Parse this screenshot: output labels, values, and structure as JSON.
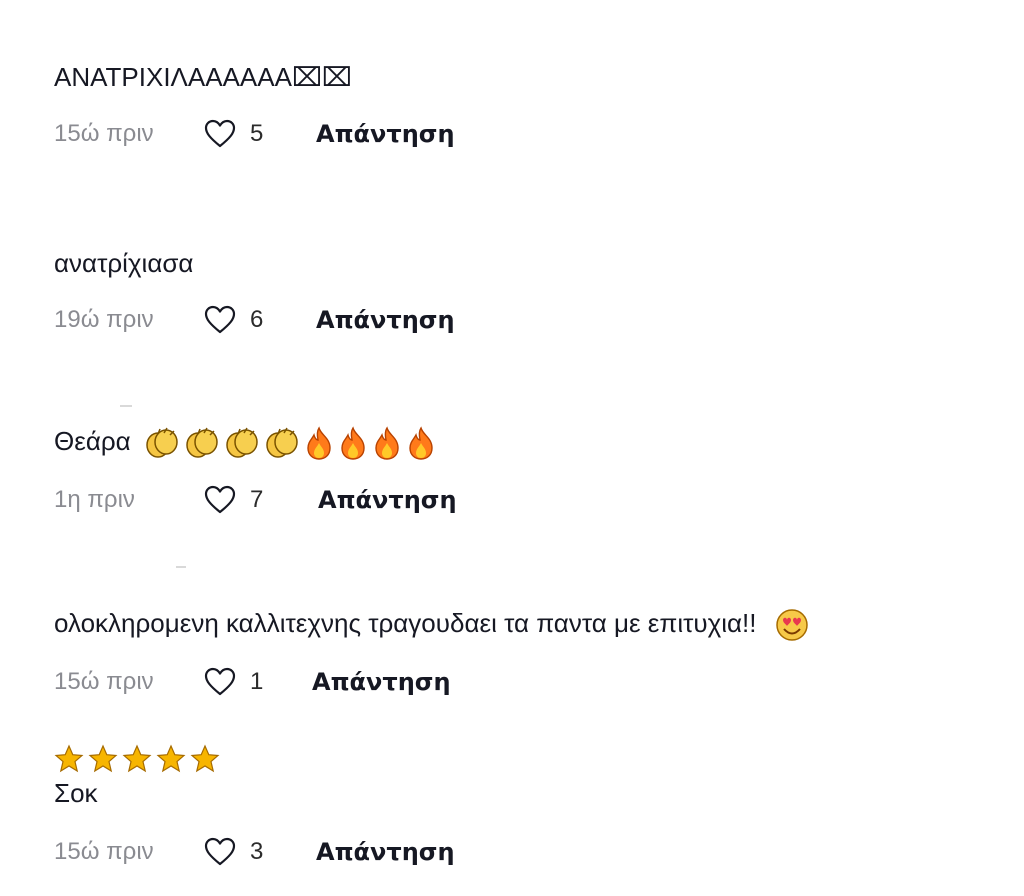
{
  "comments": [
    {
      "text": "ΑΝΑΤΡΙΧΙΛΑΑΑΑΑΑ⌧⌧",
      "time": "15ώ πριν",
      "likes": "5",
      "reply_label": "Απάντηση",
      "emojis": []
    },
    {
      "text": "ανατρίχιασα",
      "time": "19ώ πριν",
      "likes": "6",
      "reply_label": "Απάντηση",
      "emojis": []
    },
    {
      "text": "Θεάρα",
      "time": "1η πριν",
      "likes": "7",
      "reply_label": "Απάντηση",
      "emojis": [
        "clapping-hands",
        "clapping-hands",
        "clapping-hands",
        "clapping-hands",
        "fire",
        "fire",
        "fire",
        "fire"
      ]
    },
    {
      "text": "ολοκληρομενη καλλιτεχνης τραγουδαει τα παντα με επιτυχια!!",
      "time": "15ώ πριν",
      "likes": "1",
      "reply_label": "Απάντηση",
      "emojis": [
        "smiling-face-with-heart-eyes"
      ]
    },
    {
      "text": "Σοκ",
      "time": "15ώ πριν",
      "likes": "3",
      "reply_label": "Απάντηση",
      "emojis": [
        "star",
        "star",
        "star",
        "star",
        "star"
      ]
    }
  ],
  "colors": {
    "text": "#161823",
    "timestamp": "#8a8b91",
    "clap": "#f5c542",
    "fire": "#ff7a1a",
    "star": "#f7b500"
  }
}
